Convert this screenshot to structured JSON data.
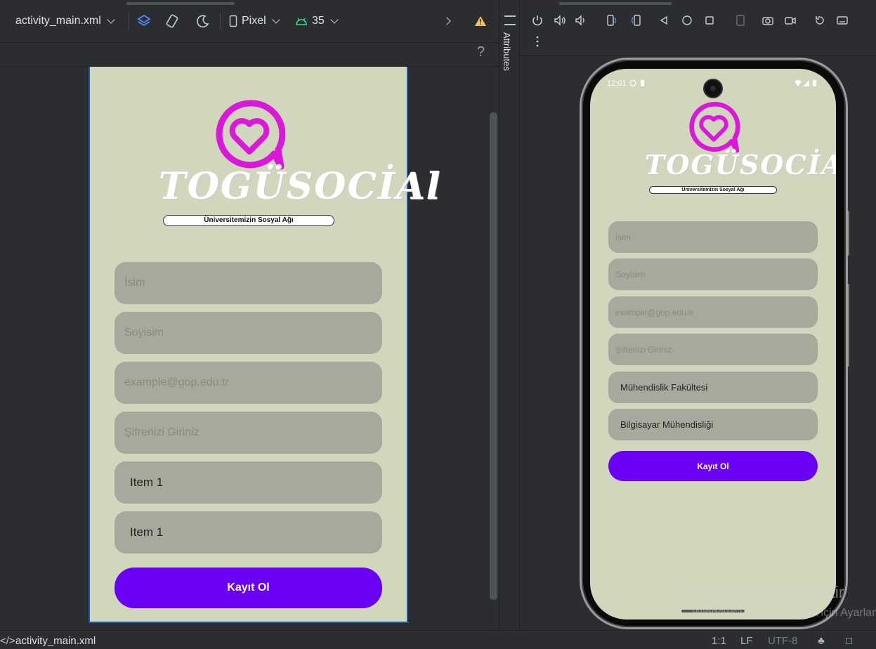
{
  "toolbar": {
    "file_name": "activity_main.xml",
    "device_label": "Pixel",
    "api_level": "35",
    "help": "?"
  },
  "attributes_panel": {
    "label": "Attributes"
  },
  "design_preview": {
    "brand": "TOGÜSOCİAl",
    "tagline": "Üniversitemizin Sosyal Ağı",
    "fields": [
      {
        "placeholder": "İsim"
      },
      {
        "placeholder": "Soyisim"
      },
      {
        "placeholder": "example@gop.edu.tr"
      },
      {
        "placeholder": "Şifrenizi Giriniz"
      }
    ],
    "spinners": [
      {
        "value": "Item 1"
      },
      {
        "value": "Item 1"
      }
    ],
    "button": "Kayıt Ol"
  },
  "emulator": {
    "status_time": "12:01",
    "brand": "TOGÜSOCİAl",
    "tagline": "Üniversitemizin Sosyal Ağı",
    "fields": [
      {
        "placeholder": "İsim"
      },
      {
        "placeholder": "Soyisim"
      },
      {
        "placeholder": "example@gop.edu.tr"
      },
      {
        "placeholder": "Şifrenizi Giriniz"
      }
    ],
    "spinners": [
      {
        "value": "Mühendislik Fakültesi"
      },
      {
        "value": "Bilgisayar Mühendisliği"
      }
    ],
    "button": "Kayıt Ol"
  },
  "watermark": {
    "title": "Windows'u Etkinleştir",
    "subtitle": "Windows'u etkinleştirmek için Ayarlar"
  },
  "statusline": {
    "file": "activity_main.xml",
    "position": "1:1",
    "line_ending": "LF",
    "encoding": "UTF-8"
  },
  "colors": {
    "accent_purple": "#6a00f4",
    "logo_magenta": "#d918d9",
    "screen_bg": "#d1d7bd",
    "field_bg": "#a8a99c"
  }
}
